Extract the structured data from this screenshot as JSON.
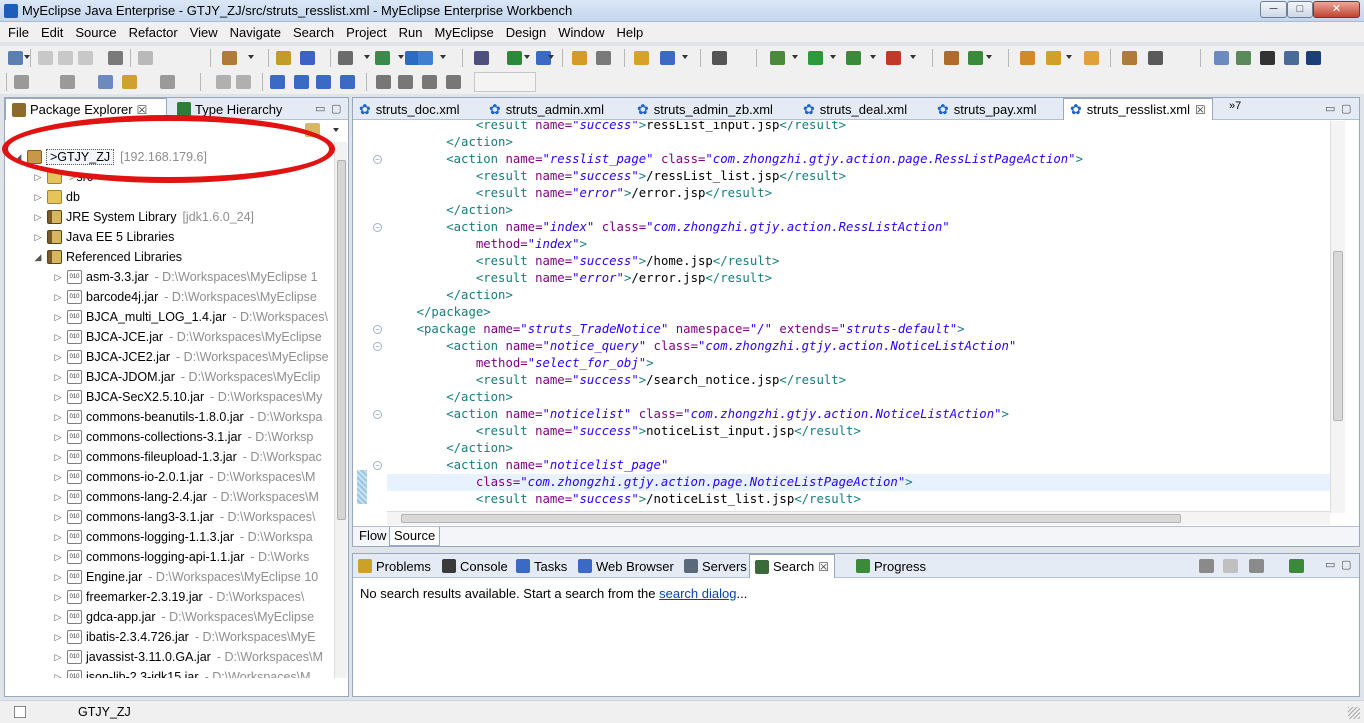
{
  "window": {
    "title": "MyEclipse Java Enterprise - GTJY_ZJ/src/struts_resslist.xml - MyEclipse Enterprise Workbench",
    "minimize": "─",
    "maximize": "□",
    "close": "✕"
  },
  "menu": [
    "File",
    "Edit",
    "Source",
    "Refactor",
    "View",
    "Navigate",
    "Search",
    "Project",
    "Run",
    "MyEclipse",
    "Design",
    "Window",
    "Help"
  ],
  "left_panel": {
    "tabs": [
      {
        "label": "Package Explorer",
        "close": "☒",
        "icon": "package-explorer-icon"
      },
      {
        "label": "Type Hierarchy",
        "icon": "type-hierarchy-icon"
      }
    ],
    "controls": {
      "minimize": "▭",
      "maximize": "▢"
    },
    "tree": {
      "project": {
        "twisty": "◢",
        "label": ">GTJY_ZJ",
        "extra": "[192.168.179.6]"
      },
      "children": [
        {
          "twisty": "▷",
          "label": "src",
          "deco": ">",
          "icon": "package-folder-icon"
        },
        {
          "twisty": "▷",
          "label": "db",
          "icon": "package-folder-icon"
        },
        {
          "twisty": "▷",
          "label": "JRE System Library",
          "extra": "[jdk1.6.0_24]",
          "icon": "library-icon"
        },
        {
          "twisty": "▷",
          "label": "Java EE 5 Libraries",
          "icon": "library-icon"
        },
        {
          "twisty": "◢",
          "label": "Referenced Libraries",
          "icon": "library-icon"
        }
      ],
      "jars": [
        {
          "label": "asm-3.3.jar",
          "path": "- D:\\Workspaces\\MyEclipse 1"
        },
        {
          "label": "barcode4j.jar",
          "path": "- D:\\Workspaces\\MyEclipse"
        },
        {
          "label": "BJCA_multi_LOG_1.4.jar",
          "path": "- D:\\Workspaces\\"
        },
        {
          "label": "BJCA-JCE.jar",
          "path": "- D:\\Workspaces\\MyEclipse"
        },
        {
          "label": "BJCA-JCE2.jar",
          "path": "- D:\\Workspaces\\MyEclipse"
        },
        {
          "label": "BJCA-JDOM.jar",
          "path": "- D:\\Workspaces\\MyEclip"
        },
        {
          "label": "BJCA-SecX2.5.10.jar",
          "path": "- D:\\Workspaces\\My"
        },
        {
          "label": "commons-beanutils-1.8.0.jar",
          "path": "- D:\\Workspa"
        },
        {
          "label": "commons-collections-3.1.jar",
          "path": "- D:\\Worksp"
        },
        {
          "label": "commons-fileupload-1.3.jar",
          "path": "- D:\\Workspac"
        },
        {
          "label": "commons-io-2.0.1.jar",
          "path": "- D:\\Workspaces\\M"
        },
        {
          "label": "commons-lang-2.4.jar",
          "path": "- D:\\Workspaces\\M"
        },
        {
          "label": "commons-lang3-3.1.jar",
          "path": "- D:\\Workspaces\\"
        },
        {
          "label": "commons-logging-1.1.3.jar",
          "path": "- D:\\Workspa"
        },
        {
          "label": "commons-logging-api-1.1.jar",
          "path": "- D:\\Works"
        },
        {
          "label": "Engine.jar",
          "path": "- D:\\Workspaces\\MyEclipse 10"
        },
        {
          "label": "freemarker-2.3.19.jar",
          "path": "- D:\\Workspaces\\"
        },
        {
          "label": "gdca-app.jar",
          "path": "- D:\\Workspaces\\MyEclipse"
        },
        {
          "label": "ibatis-2.3.4.726.jar",
          "path": "- D:\\Workspaces\\MyE"
        },
        {
          "label": "javassist-3.11.0.GA.jar",
          "path": "- D:\\Workspaces\\M"
        },
        {
          "label": "json-lib-2.3-jdk15.jar",
          "path": "- D:\\Workspaces\\M"
        }
      ]
    }
  },
  "editor": {
    "tabs": [
      {
        "label": "struts_doc.xml"
      },
      {
        "label": "struts_admin.xml"
      },
      {
        "label": "struts_admin_zb.xml"
      },
      {
        "label": "struts_deal.xml"
      },
      {
        "label": "struts_pay.xml"
      },
      {
        "label": "struts_resslist.xml",
        "close": "☒",
        "active": true
      }
    ],
    "overflow": "»7",
    "code_lines": [
      {
        "indent": "            ",
        "parts": [
          [
            "t",
            "<result "
          ],
          [
            "a",
            "name="
          ],
          [
            "s",
            "\"success\""
          ],
          [
            "t",
            ">"
          ],
          [
            "txt",
            "ressList_input.jsp"
          ],
          [
            "t",
            "</result>"
          ]
        ]
      },
      {
        "indent": "        ",
        "parts": [
          [
            "t",
            "</action>"
          ]
        ]
      },
      {
        "indent": "        ",
        "parts": [
          [
            "t",
            "<action "
          ],
          [
            "a",
            "name="
          ],
          [
            "s",
            "\"resslist_page\""
          ],
          [
            "a",
            " class="
          ],
          [
            "s",
            "\"com.zhongzhi.gtjy.action.page.RessListPageAction\""
          ],
          [
            "t",
            ">"
          ]
        ]
      },
      {
        "indent": "            ",
        "parts": [
          [
            "t",
            "<result "
          ],
          [
            "a",
            "name="
          ],
          [
            "s",
            "\"success\""
          ],
          [
            "t",
            ">"
          ],
          [
            "txt",
            "/ressList_list.jsp"
          ],
          [
            "t",
            "</result>"
          ]
        ]
      },
      {
        "indent": "            ",
        "parts": [
          [
            "t",
            "<result "
          ],
          [
            "a",
            "name="
          ],
          [
            "s",
            "\"error\""
          ],
          [
            "t",
            ">"
          ],
          [
            "txt",
            "/error.jsp"
          ],
          [
            "t",
            "</result>"
          ]
        ]
      },
      {
        "indent": "        ",
        "parts": [
          [
            "t",
            "</action>"
          ]
        ]
      },
      {
        "indent": "        ",
        "parts": [
          [
            "t",
            "<action "
          ],
          [
            "a",
            "name="
          ],
          [
            "s",
            "\"index\""
          ],
          [
            "a",
            " class="
          ],
          [
            "s",
            "\"com.zhongzhi.gtjy.action.RessListAction\""
          ]
        ]
      },
      {
        "indent": "            ",
        "parts": [
          [
            "a",
            "method="
          ],
          [
            "s",
            "\"index\""
          ],
          [
            "t",
            ">"
          ]
        ]
      },
      {
        "indent": "            ",
        "parts": [
          [
            "t",
            "<result "
          ],
          [
            "a",
            "name="
          ],
          [
            "s",
            "\"success\""
          ],
          [
            "t",
            ">"
          ],
          [
            "txt",
            "/home.jsp"
          ],
          [
            "t",
            "</result>"
          ]
        ]
      },
      {
        "indent": "            ",
        "parts": [
          [
            "t",
            "<result "
          ],
          [
            "a",
            "name="
          ],
          [
            "s",
            "\"error\""
          ],
          [
            "t",
            ">"
          ],
          [
            "txt",
            "/error.jsp"
          ],
          [
            "t",
            "</result>"
          ]
        ]
      },
      {
        "indent": "        ",
        "parts": [
          [
            "t",
            "</action>"
          ]
        ]
      },
      {
        "indent": "    ",
        "parts": [
          [
            "t",
            "</package>"
          ]
        ]
      },
      {
        "indent": "    ",
        "parts": [
          [
            "t",
            "<package "
          ],
          [
            "a",
            "name="
          ],
          [
            "s",
            "\"struts_TradeNotice\""
          ],
          [
            "a",
            " namespace="
          ],
          [
            "s",
            "\"/\""
          ],
          [
            "a",
            " extends="
          ],
          [
            "s",
            "\"struts-default\""
          ],
          [
            "t",
            ">"
          ]
        ]
      },
      {
        "indent": "        ",
        "parts": [
          [
            "t",
            "<action "
          ],
          [
            "a",
            "name="
          ],
          [
            "s",
            "\"notice_query\""
          ],
          [
            "a",
            " class="
          ],
          [
            "s",
            "\"com.zhongzhi.gtjy.action.NoticeListAction\""
          ]
        ]
      },
      {
        "indent": "            ",
        "parts": [
          [
            "a",
            "method="
          ],
          [
            "s",
            "\"select_for_obj\""
          ],
          [
            "t",
            ">"
          ]
        ]
      },
      {
        "indent": "            ",
        "parts": [
          [
            "t",
            "<result "
          ],
          [
            "a",
            "name="
          ],
          [
            "s",
            "\"success\""
          ],
          [
            "t",
            ">"
          ],
          [
            "txt",
            "/search_notice.jsp"
          ],
          [
            "t",
            "</result>"
          ]
        ]
      },
      {
        "indent": "        ",
        "parts": [
          [
            "t",
            "</action>"
          ]
        ]
      },
      {
        "indent": "        ",
        "parts": [
          [
            "t",
            "<action "
          ],
          [
            "a",
            "name="
          ],
          [
            "s",
            "\"noticelist\""
          ],
          [
            "a",
            " class="
          ],
          [
            "s",
            "\"com.zhongzhi.gtjy.action.NoticeListAction\""
          ],
          [
            "t",
            ">"
          ]
        ]
      },
      {
        "indent": "            ",
        "parts": [
          [
            "t",
            "<result "
          ],
          [
            "a",
            "name="
          ],
          [
            "s",
            "\"success\""
          ],
          [
            "t",
            ">"
          ],
          [
            "txt",
            "noticeList_input.jsp"
          ],
          [
            "t",
            "</result>"
          ]
        ]
      },
      {
        "indent": "        ",
        "parts": [
          [
            "t",
            "</action>"
          ]
        ]
      },
      {
        "indent": "        ",
        "parts": [
          [
            "t",
            "<action "
          ],
          [
            "a",
            "name="
          ],
          [
            "s",
            "\"noticelist_page\""
          ]
        ]
      },
      {
        "indent": "            ",
        "parts": [
          [
            "a",
            "class="
          ],
          [
            "s",
            "\"com.zhongzhi.gtjy.action.page.NoticeListPageAction\""
          ],
          [
            "t",
            ">"
          ]
        ],
        "current": true
      },
      {
        "indent": "            ",
        "parts": [
          [
            "t",
            "<result "
          ],
          [
            "a",
            "name="
          ],
          [
            "s",
            "\"success\""
          ],
          [
            "t",
            ">"
          ],
          [
            "txt",
            "/noticeList_list.jsp"
          ],
          [
            "t",
            "</result>"
          ]
        ]
      }
    ],
    "fold_lines": [
      2,
      6,
      12,
      13,
      17,
      20
    ],
    "bottom_tabs": [
      "Flow",
      "Source"
    ]
  },
  "bottom_panel": {
    "tabs": [
      {
        "label": "Problems",
        "icon": "problems-icon"
      },
      {
        "label": "Console",
        "icon": "console-icon"
      },
      {
        "label": "Tasks",
        "icon": "tasks-icon"
      },
      {
        "label": "Web Browser",
        "icon": "web-browser-icon"
      },
      {
        "label": "Servers",
        "icon": "servers-icon"
      },
      {
        "label": "Search",
        "icon": "search-icon",
        "close": "☒",
        "active": true
      },
      {
        "label": "Progress",
        "icon": "progress-icon"
      }
    ],
    "message_prefix": "No search results available. Start a search from the ",
    "message_link": "search dialog",
    "message_suffix": "..."
  },
  "status_bar": {
    "text": "GTJY_ZJ"
  },
  "colors": {
    "annotation": "#e11212",
    "tag": "#177c7c",
    "attr": "#7f007f",
    "value": "#2a00ff"
  }
}
